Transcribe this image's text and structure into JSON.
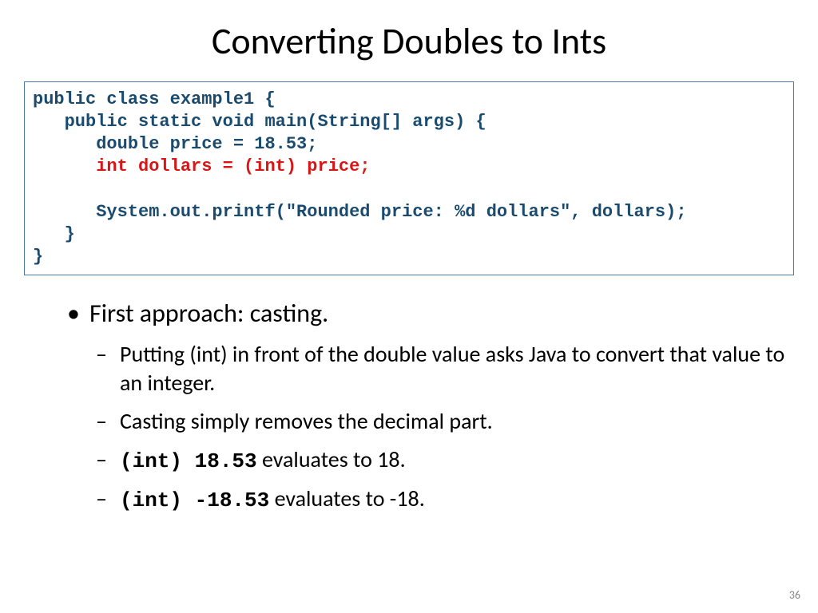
{
  "title": "Converting Doubles to Ints",
  "code": {
    "line1": "public class example1 {",
    "line2": "   public static void main(String[] args) {",
    "line3": "      double price = 18.53;",
    "line4": "      int dollars = (int) price;",
    "line5": "",
    "line6": "      System.out.printf(\"Rounded price: %d dollars\", dollars);",
    "line7": "   }",
    "line8": "}"
  },
  "bullets": {
    "b1": "First approach: casting.",
    "b2a": "Putting (int) in front of the double value asks Java to convert that value to an integer.",
    "b2b": "Casting simply removes the decimal part.",
    "b2c_code": "(int) 18.53",
    "b2c_text": " evaluates to 18.",
    "b2d_code": "(int) -18.53",
    "b2d_text": " evaluates to -18."
  },
  "page_number": "36"
}
